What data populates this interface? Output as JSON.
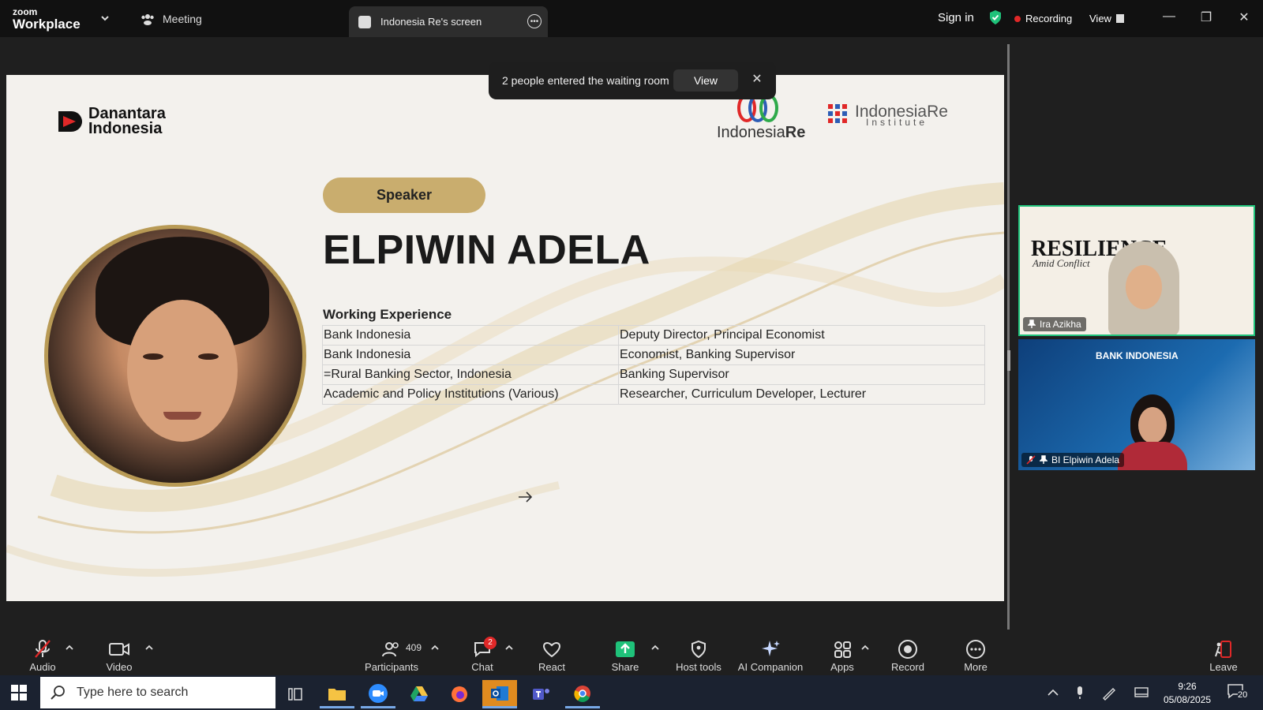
{
  "app": {
    "brand_top": "zoom",
    "brand_bottom": "Workplace",
    "meeting_label": "Meeting",
    "tab_label": "Indonesia Re's screen",
    "sign_in": "Sign in",
    "recording_label": "Recording",
    "view_label": "View"
  },
  "toast": {
    "message": "2 people entered the waiting room",
    "view_label": "View",
    "close_glyph": "✕"
  },
  "slide": {
    "logo_danantara_line1": "Danantara",
    "logo_danantara_line2": "Indonesia",
    "logo_ire_main": "Indonesia",
    "logo_ire_bold": "Re",
    "logo_iri_main": "IndonesiaRe",
    "logo_iri_sub": "Institute",
    "speaker_label": "Speaker",
    "name": "ELPIWIN ADELA",
    "experience_title": "Working Experience",
    "experience": [
      {
        "org": "Bank Indonesia",
        "role": "Deputy Director, Principal Economist"
      },
      {
        "org": "Bank Indonesia",
        "role": "Economist, Banking Supervisor"
      },
      {
        "org": "=Rural Banking Sector, Indonesia",
        "role": "Banking Supervisor"
      },
      {
        "org": "Academic and Policy Institutions (Various)",
        "role": "Researcher, Curriculum Developer, Lecturer"
      }
    ]
  },
  "tiles": [
    {
      "name": "Ira Azikha",
      "slide_title": "RESILIENCE",
      "slide_subtitle": "Amid Conflict"
    },
    {
      "name": "BI Elpiwin Adela",
      "logo_text": "BANK INDONESIA"
    }
  ],
  "toolbar": {
    "audio": "Audio",
    "video": "Video",
    "participants": "Participants",
    "participant_count": "409",
    "chat": "Chat",
    "chat_badge": "2",
    "react": "React",
    "share": "Share",
    "host_tools": "Host tools",
    "ai_companion": "AI Companion",
    "apps": "Apps",
    "record": "Record",
    "more": "More",
    "leave": "Leave"
  },
  "taskbar": {
    "search_placeholder": "Type here to search",
    "time": "9:26",
    "date": "05/08/2025",
    "notif_count": "20"
  },
  "colors": {
    "accent_green": "#1fc27a",
    "record_red": "#e02828",
    "speaker_gold": "#c9ad6e",
    "share_green": "#1fc27a"
  }
}
